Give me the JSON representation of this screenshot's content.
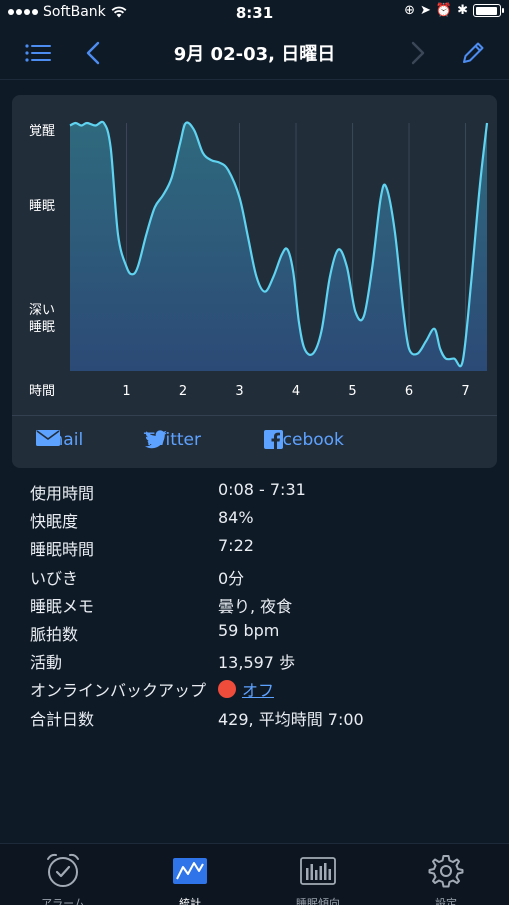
{
  "status_bar": {
    "carrier": "SoftBank",
    "time": "8:31",
    "battery_level": 0.95
  },
  "nav": {
    "title": "9月 02-03, 日曜日"
  },
  "chart": {
    "y_labels": {
      "awake": "覚醒",
      "sleep": "睡眠",
      "deep_line1": "深い",
      "deep_line2": "睡眠"
    },
    "x_label": "時間",
    "x_ticks": [
      "1",
      "2",
      "3",
      "4",
      "5",
      "6",
      "7"
    ],
    "accent_color": "#5fd3f0"
  },
  "chart_data": {
    "type": "area",
    "xlabel": "時間",
    "ylabel": "",
    "y_categories": [
      "深い睡眠",
      "睡眠",
      "覚醒"
    ],
    "ylim": [
      0,
      1
    ],
    "xlim": [
      0,
      7.38
    ],
    "series": [
      {
        "x": [
          0,
          0.1,
          0.2,
          0.3,
          0.45,
          0.6,
          0.72,
          0.85,
          1.0,
          1.1,
          1.2,
          1.35,
          1.5,
          1.65,
          1.8,
          1.95,
          2.05,
          2.2,
          2.35,
          2.5,
          2.65,
          2.8,
          3.0,
          3.15,
          3.3,
          3.45,
          3.6,
          3.75,
          3.85,
          3.95,
          4.05,
          4.15,
          4.3,
          4.45,
          4.6,
          4.75,
          4.9,
          5.05,
          5.2,
          5.35,
          5.5,
          5.6,
          5.75,
          5.9,
          6.0,
          6.15,
          6.3,
          6.45,
          6.55,
          6.65,
          6.8,
          6.95,
          7.1,
          7.25,
          7.38
        ],
        "values": [
          0.99,
          1.0,
          0.99,
          1.0,
          0.99,
          1.0,
          0.9,
          0.55,
          0.42,
          0.39,
          0.42,
          0.55,
          0.66,
          0.71,
          0.78,
          0.92,
          1.0,
          0.97,
          0.88,
          0.85,
          0.84,
          0.81,
          0.7,
          0.54,
          0.38,
          0.32,
          0.38,
          0.47,
          0.49,
          0.4,
          0.2,
          0.09,
          0.07,
          0.16,
          0.38,
          0.49,
          0.42,
          0.24,
          0.22,
          0.42,
          0.7,
          0.74,
          0.56,
          0.24,
          0.09,
          0.07,
          0.12,
          0.17,
          0.09,
          0.05,
          0.05,
          0.04,
          0.36,
          0.74,
          1.0
        ]
      }
    ]
  },
  "share": {
    "email": "Email",
    "twitter": "Twitter",
    "facebook": "Facebook"
  },
  "details": {
    "rows": [
      {
        "label": "使用時間",
        "value": "0:08 - 7:31"
      },
      {
        "label": "快眠度",
        "value": "84%"
      },
      {
        "label": "睡眠時間",
        "value": "7:22"
      },
      {
        "label": "いびき",
        "value": "0分"
      },
      {
        "label": "睡眠メモ",
        "value": "曇り, 夜食"
      },
      {
        "label": "脈拍数",
        "value": "59 bpm"
      },
      {
        "label": "活動",
        "value": "13,597 歩"
      },
      {
        "label": "オンラインバックアップ",
        "value": "オフ",
        "status_color": "#ef4c3c"
      },
      {
        "label": "合計日数",
        "value": "429, 平均時間 7:00"
      }
    ]
  },
  "tabs": [
    {
      "label": "アラーム",
      "icon": "alarm-clock-icon"
    },
    {
      "label": "統計",
      "icon": "stats-graph-icon",
      "active": true
    },
    {
      "label": "睡眠傾向",
      "icon": "trend-bars-icon"
    },
    {
      "label": "設定",
      "icon": "gear-icon"
    }
  ]
}
